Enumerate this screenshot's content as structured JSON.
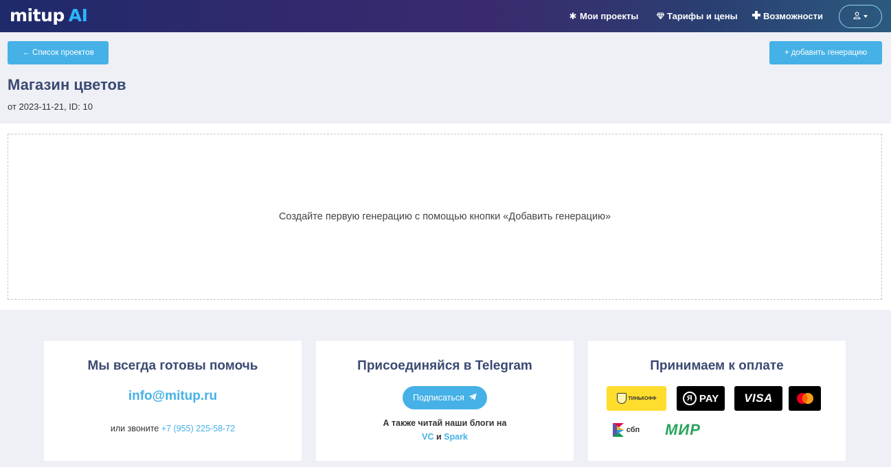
{
  "header": {
    "logo_main": "mitup",
    "logo_accent": "AI",
    "nav": [
      {
        "label": "Мои проекты",
        "icon": "asterisk-icon"
      },
      {
        "label": "Тарифы и цены",
        "icon": "diamond-icon"
      },
      {
        "label": "Возможности",
        "icon": "plus-cross-icon"
      }
    ],
    "user_menu_icon": "user-icon"
  },
  "toolbar": {
    "back_label": "← Список проектов",
    "add_label": "+ добавить генерацию"
  },
  "project": {
    "title": "Магазин цветов",
    "meta": "от 2023-11-21,  ID: 10"
  },
  "generations": {
    "empty_message": "Создайте первую генерацию с помощью кнопки «Добавить генерацию»"
  },
  "footer": {
    "support": {
      "title": "Мы всегда готовы помочь",
      "email": "info@mitup.ru",
      "phone_prefix": "или звоните",
      "phone": "+7 (955) 225-58-72"
    },
    "telegram": {
      "title": "Присоединяйся в Telegram",
      "subscribe_label": "Подписаться",
      "blogs_text": "А также читай наши блоги на",
      "blog_vc": "VC",
      "blog_and": "и",
      "blog_spark": "Spark"
    },
    "payment": {
      "title": "Принимаем к оплате",
      "methods": {
        "tinkoff": "ТИНЬКОФФ",
        "yapay_y": "Я",
        "yapay": "PAY",
        "visa": "VISA",
        "sbp": "сбп",
        "mir": "МИР"
      }
    }
  },
  "colors": {
    "accent": "#45b1e6",
    "title": "#3b4a72",
    "tinkoff_yellow": "#ffdd2d",
    "mir_green": "#28a45c"
  }
}
